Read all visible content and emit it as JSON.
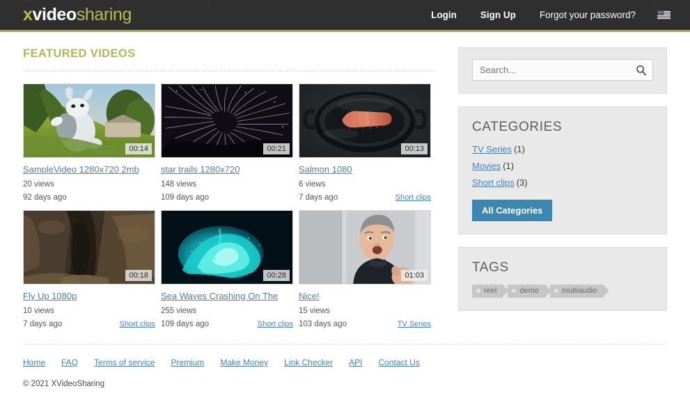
{
  "header": {
    "logo": {
      "part1": "x",
      "part2": "video",
      "part3": "sharing"
    },
    "nav": [
      {
        "label": "Login",
        "name": "login"
      },
      {
        "label": "Sign Up",
        "name": "signup"
      },
      {
        "label": "Forgot your password?",
        "name": "forgot-password"
      }
    ],
    "flag_icon": "us-flag-icon",
    "accent_color": "#a8ad52",
    "background_color": "#2f2f2f"
  },
  "main": {
    "section_title": "Featured Videos",
    "videos": [
      {
        "title": "SampleVideo 1280x720 2mb",
        "duration": "00:14",
        "views": "20 views",
        "date": "92 days ago",
        "category": ""
      },
      {
        "title": "star trails 1280x720",
        "duration": "00:21",
        "views": "148 views",
        "date": "109 days ago",
        "category": ""
      },
      {
        "title": "Salmon 1080",
        "duration": "00:13",
        "views": "6 views",
        "date": "7 days ago",
        "category": "Short clips"
      },
      {
        "title": "Fly Up 1080p",
        "duration": "00:18",
        "views": "10 views",
        "date": "7 days ago",
        "category": "Short clips"
      },
      {
        "title": "Sea Waves Crashing On The",
        "duration": "00:28",
        "views": "255 views",
        "date": "109 days ago",
        "category": "Short clips"
      },
      {
        "title": "Nice!",
        "duration": "01:03",
        "views": "15 views",
        "date": "103 days ago",
        "category": "TV Series"
      }
    ]
  },
  "sidebar": {
    "search": {
      "placeholder": "Search...",
      "value": "",
      "icon": "search-icon"
    },
    "categories": {
      "title": "CATEGORIES",
      "items": [
        {
          "label": "TV Series",
          "count": "(1)"
        },
        {
          "label": "Movies",
          "count": "(1)"
        },
        {
          "label": "Short clips",
          "count": "(3)"
        }
      ],
      "button_label": "All Categories",
      "button_color": "#3b87b4"
    },
    "tags": {
      "title": "TAGS",
      "items": [
        {
          "label": "reel"
        },
        {
          "label": "demo"
        },
        {
          "label": "multiaudio"
        }
      ]
    }
  },
  "footer": {
    "links": [
      {
        "label": "Home"
      },
      {
        "label": "FAQ"
      },
      {
        "label": "Terms of service"
      },
      {
        "label": "Premium"
      },
      {
        "label": "Make Money"
      },
      {
        "label": "Link Checker"
      },
      {
        "label": "API"
      },
      {
        "label": "Contact Us"
      }
    ],
    "copyright": "© 2021 XVideoSharing"
  }
}
